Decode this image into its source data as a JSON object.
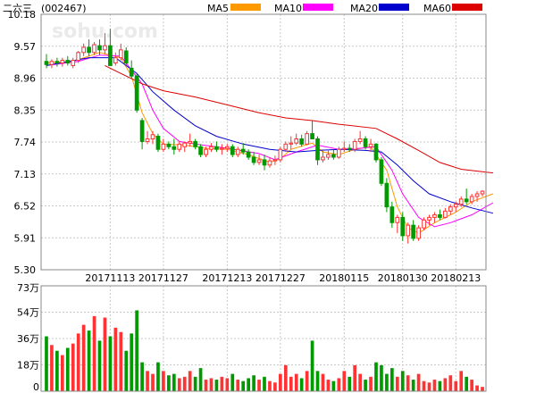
{
  "header": {
    "stock_name": "二六三",
    "stock_code": "(002467)",
    "watermark": "sohu.com"
  },
  "legend": [
    {
      "label": "MA5",
      "color": "#ff9900"
    },
    {
      "label": "MA10",
      "color": "#ff00ff"
    },
    {
      "label": "MA20",
      "color": "#0000cc"
    },
    {
      "label": "MA60",
      "color": "#dd0000"
    }
  ],
  "colors": {
    "up": "#ff3333",
    "down": "#009900",
    "grid": "#c8c8c8",
    "frame": "#888888"
  },
  "chart_data": {
    "type": "candlestick",
    "price_axis": {
      "ticks": [
        "10.18",
        "9.57",
        "8.96",
        "8.35",
        "7.74",
        "7.13",
        "6.52",
        "5.91",
        "5.30"
      ],
      "ylim": [
        5.3,
        10.18
      ]
    },
    "volume_axis": {
      "ticks": [
        "73万",
        "54万",
        "36万",
        "18万",
        "0"
      ],
      "ylim": [
        0,
        73
      ]
    },
    "x_labels": [
      {
        "label": "20171113",
        "index": 12
      },
      {
        "label": "20171127",
        "index": 22
      },
      {
        "label": "20171213",
        "index": 34
      },
      {
        "label": "20171227",
        "index": 44
      },
      {
        "label": "20180115",
        "index": 56
      },
      {
        "label": "20180130",
        "index": 67
      },
      {
        "label": "20180213",
        "index": 77
      }
    ],
    "candles": [
      [
        9.28,
        9.42,
        9.15,
        9.22,
        38
      ],
      [
        9.22,
        9.32,
        9.15,
        9.28,
        32
      ],
      [
        9.28,
        9.35,
        9.18,
        9.25,
        28
      ],
      [
        9.25,
        9.35,
        9.18,
        9.3,
        25
      ],
      [
        9.3,
        9.38,
        9.2,
        9.25,
        30
      ],
      [
        9.2,
        9.35,
        9.15,
        9.3,
        33
      ],
      [
        9.3,
        9.48,
        9.25,
        9.45,
        40
      ],
      [
        9.45,
        9.62,
        9.38,
        9.55,
        46
      ],
      [
        9.55,
        9.7,
        9.38,
        9.45,
        42
      ],
      [
        9.45,
        9.65,
        9.4,
        9.6,
        52
      ],
      [
        9.58,
        9.7,
        9.4,
        9.5,
        35
      ],
      [
        9.5,
        9.82,
        9.42,
        9.58,
        51
      ],
      [
        9.58,
        9.9,
        9.25,
        9.2,
        38
      ],
      [
        9.25,
        9.45,
        9.2,
        9.35,
        44
      ],
      [
        9.35,
        9.62,
        9.3,
        9.5,
        41
      ],
      [
        9.48,
        9.55,
        9.2,
        9.25,
        28
      ],
      [
        9.15,
        9.3,
        8.95,
        9.0,
        40
      ],
      [
        9.0,
        9.05,
        8.3,
        8.35,
        56
      ],
      [
        8.15,
        8.2,
        7.6,
        7.75,
        20
      ],
      [
        7.75,
        7.95,
        7.7,
        7.8,
        14
      ],
      [
        7.8,
        7.95,
        7.7,
        7.88,
        12
      ],
      [
        7.85,
        7.9,
        7.55,
        7.6,
        20
      ],
      [
        7.6,
        7.8,
        7.55,
        7.7,
        14
      ],
      [
        7.7,
        7.75,
        7.6,
        7.65,
        11
      ],
      [
        7.65,
        7.8,
        7.5,
        7.6,
        12
      ],
      [
        7.6,
        7.75,
        7.55,
        7.7,
        9
      ],
      [
        7.65,
        7.75,
        7.55,
        7.72,
        10
      ],
      [
        7.72,
        7.9,
        7.65,
        7.75,
        14
      ],
      [
        7.75,
        7.8,
        7.6,
        7.65,
        10
      ],
      [
        7.65,
        7.7,
        7.45,
        7.5,
        16
      ],
      [
        7.5,
        7.65,
        7.45,
        7.6,
        8
      ],
      [
        7.6,
        7.72,
        7.55,
        7.65,
        9
      ],
      [
        7.65,
        7.75,
        7.55,
        7.6,
        8
      ],
      [
        7.6,
        7.7,
        7.5,
        7.62,
        10
      ],
      [
        7.62,
        7.7,
        7.55,
        7.65,
        9
      ],
      [
        7.65,
        7.7,
        7.45,
        7.5,
        12
      ],
      [
        7.5,
        7.65,
        7.45,
        7.6,
        8
      ],
      [
        7.6,
        7.72,
        7.5,
        7.55,
        7
      ],
      [
        7.55,
        7.6,
        7.4,
        7.45,
        9
      ],
      [
        7.45,
        7.55,
        7.3,
        7.35,
        11
      ],
      [
        7.35,
        7.5,
        7.3,
        7.4,
        8
      ],
      [
        7.4,
        7.5,
        7.2,
        7.3,
        10
      ],
      [
        7.3,
        7.45,
        7.25,
        7.38,
        7
      ],
      [
        7.38,
        7.48,
        7.3,
        7.4,
        6
      ],
      [
        7.4,
        7.65,
        7.35,
        7.6,
        12
      ],
      [
        7.6,
        7.75,
        7.55,
        7.7,
        18
      ],
      [
        7.7,
        7.85,
        7.6,
        7.72,
        10
      ],
      [
        7.72,
        7.9,
        7.68,
        7.8,
        12
      ],
      [
        7.8,
        7.88,
        7.65,
        7.7,
        9
      ],
      [
        7.7,
        7.95,
        7.68,
        7.9,
        14
      ],
      [
        7.9,
        8.15,
        7.8,
        7.8,
        35
      ],
      [
        7.8,
        7.85,
        7.3,
        7.4,
        14
      ],
      [
        7.4,
        7.6,
        7.35,
        7.45,
        12
      ],
      [
        7.45,
        7.6,
        7.4,
        7.5,
        8
      ],
      [
        7.5,
        7.6,
        7.4,
        7.45,
        7
      ],
      [
        7.45,
        7.65,
        7.42,
        7.6,
        9
      ],
      [
        7.6,
        7.75,
        7.55,
        7.62,
        14
      ],
      [
        7.62,
        7.7,
        7.55,
        7.6,
        10
      ],
      [
        7.6,
        7.8,
        7.55,
        7.75,
        18
      ],
      [
        7.75,
        7.95,
        7.7,
        7.8,
        12
      ],
      [
        7.8,
        7.85,
        7.6,
        7.65,
        8
      ],
      [
        7.65,
        7.8,
        7.55,
        7.7,
        10
      ],
      [
        7.7,
        7.72,
        7.35,
        7.4,
        20
      ],
      [
        7.4,
        7.45,
        6.9,
        6.95,
        18
      ],
      [
        6.95,
        7.05,
        6.4,
        6.5,
        12
      ],
      [
        6.5,
        6.6,
        6.1,
        6.2,
        16
      ],
      [
        6.2,
        6.35,
        6.0,
        6.3,
        10
      ],
      [
        6.3,
        6.4,
        5.85,
        5.95,
        14
      ],
      [
        5.95,
        6.2,
        5.8,
        6.15,
        11
      ],
      [
        6.15,
        6.25,
        5.85,
        5.9,
        8
      ],
      [
        5.9,
        6.15,
        5.85,
        6.1,
        12
      ],
      [
        6.1,
        6.3,
        6.05,
        6.25,
        7
      ],
      [
        6.25,
        6.35,
        6.15,
        6.3,
        6
      ],
      [
        6.3,
        6.4,
        6.2,
        6.35,
        8
      ],
      [
        6.35,
        6.45,
        6.25,
        6.3,
        7
      ],
      [
        6.3,
        6.48,
        6.28,
        6.42,
        9
      ],
      [
        6.42,
        6.55,
        6.35,
        6.5,
        11
      ],
      [
        6.5,
        6.6,
        6.4,
        6.55,
        7
      ],
      [
        6.55,
        6.7,
        6.5,
        6.65,
        14
      ],
      [
        6.65,
        6.85,
        6.55,
        6.6,
        10
      ],
      [
        6.6,
        6.75,
        6.55,
        6.7,
        8
      ],
      [
        6.7,
        6.8,
        6.6,
        6.75,
        4
      ],
      [
        6.75,
        6.82,
        6.7,
        6.8,
        3
      ]
    ],
    "ma": {
      "MA5": [
        [
          0,
          9.25
        ],
        [
          5,
          9.28
        ],
        [
          10,
          9.45
        ],
        [
          14,
          9.35
        ],
        [
          16,
          9.0
        ],
        [
          18,
          8.3
        ],
        [
          20,
          7.9
        ],
        [
          22,
          7.7
        ],
        [
          26,
          7.68
        ],
        [
          30,
          7.62
        ],
        [
          34,
          7.6
        ],
        [
          38,
          7.5
        ],
        [
          42,
          7.35
        ],
        [
          44,
          7.42
        ],
        [
          46,
          7.6
        ],
        [
          50,
          7.72
        ],
        [
          52,
          7.55
        ],
        [
          55,
          7.5
        ],
        [
          58,
          7.6
        ],
        [
          61,
          7.65
        ],
        [
          64,
          7.2
        ],
        [
          66,
          6.5
        ],
        [
          68,
          6.1
        ],
        [
          70,
          6.0
        ],
        [
          73,
          6.2
        ],
        [
          77,
          6.4
        ],
        [
          80,
          6.6
        ],
        [
          84,
          6.75
        ]
      ],
      "MA10": [
        [
          0,
          9.2
        ],
        [
          6,
          9.28
        ],
        [
          10,
          9.4
        ],
        [
          14,
          9.38
        ],
        [
          18,
          8.85
        ],
        [
          20,
          8.35
        ],
        [
          22,
          8.0
        ],
        [
          25,
          7.75
        ],
        [
          28,
          7.7
        ],
        [
          34,
          7.62
        ],
        [
          40,
          7.52
        ],
        [
          43,
          7.4
        ],
        [
          47,
          7.55
        ],
        [
          51,
          7.68
        ],
        [
          55,
          7.6
        ],
        [
          59,
          7.62
        ],
        [
          62,
          7.65
        ],
        [
          65,
          7.2
        ],
        [
          67,
          6.75
        ],
        [
          70,
          6.3
        ],
        [
          73,
          6.12
        ],
        [
          76,
          6.2
        ],
        [
          80,
          6.35
        ],
        [
          84,
          6.58
        ]
      ],
      "MA20": [
        [
          0,
          9.2
        ],
        [
          8,
          9.35
        ],
        [
          13,
          9.35
        ],
        [
          17,
          9.05
        ],
        [
          20,
          8.7
        ],
        [
          24,
          8.35
        ],
        [
          28,
          8.05
        ],
        [
          32,
          7.85
        ],
        [
          37,
          7.7
        ],
        [
          42,
          7.6
        ],
        [
          47,
          7.55
        ],
        [
          51,
          7.58
        ],
        [
          55,
          7.6
        ],
        [
          60,
          7.58
        ],
        [
          63,
          7.55
        ],
        [
          66,
          7.3
        ],
        [
          69,
          7.0
        ],
        [
          72,
          6.75
        ],
        [
          76,
          6.6
        ],
        [
          80,
          6.48
        ],
        [
          84,
          6.38
        ]
      ],
      "MA60": [
        [
          11,
          9.2
        ],
        [
          15,
          9.0
        ],
        [
          18,
          8.85
        ],
        [
          22,
          8.72
        ],
        [
          28,
          8.6
        ],
        [
          34,
          8.45
        ],
        [
          40,
          8.3
        ],
        [
          45,
          8.2
        ],
        [
          50,
          8.15
        ],
        [
          55,
          8.08
        ],
        [
          62,
          8.0
        ],
        [
          66,
          7.8
        ],
        [
          70,
          7.58
        ],
        [
          74,
          7.35
        ],
        [
          78,
          7.22
        ],
        [
          84,
          7.15
        ]
      ]
    }
  }
}
